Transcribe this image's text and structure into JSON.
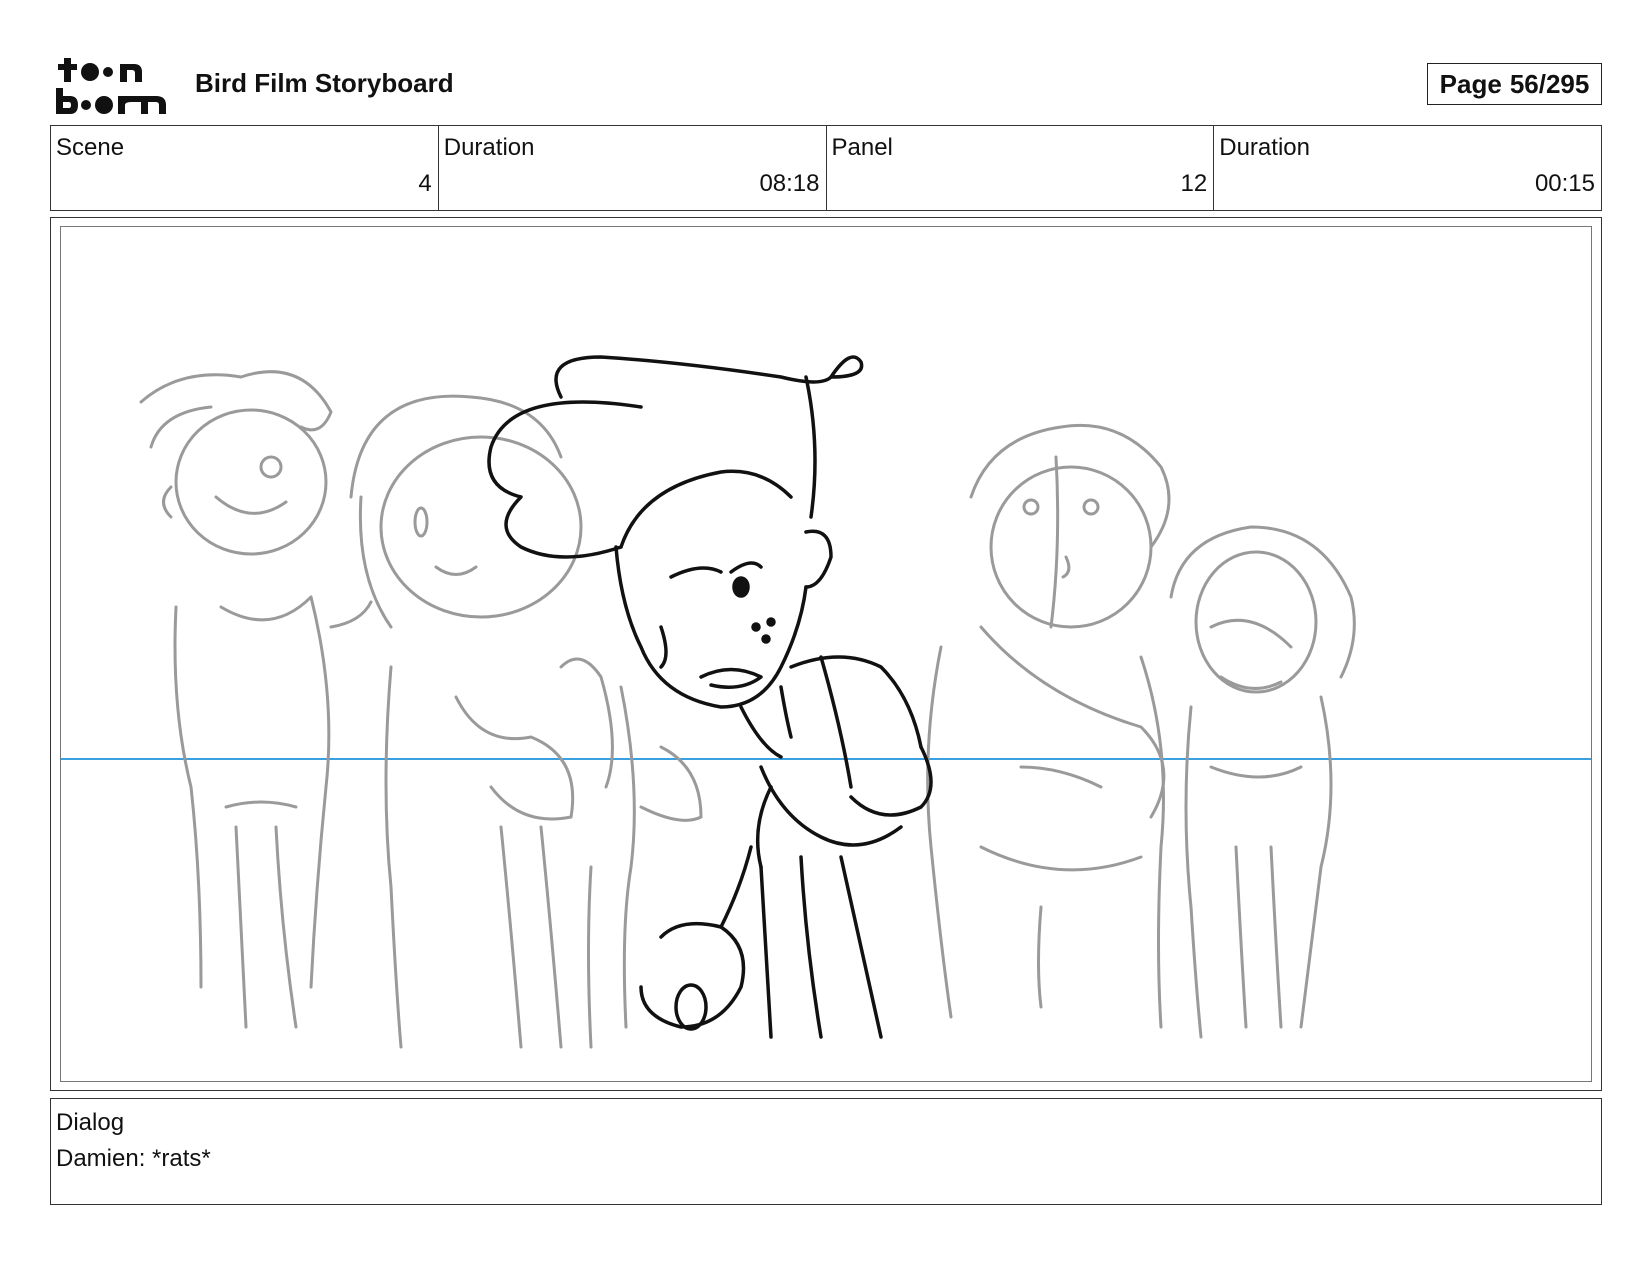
{
  "header": {
    "logo_text_line1": "toon",
    "logo_text_line2": "boom",
    "title": "Bird Film Storyboard",
    "page_label": "Page",
    "page_value": "56/295"
  },
  "info": {
    "scene_label": "Scene",
    "scene_value": "4",
    "scene_duration_label": "Duration",
    "scene_duration_value": "08:18",
    "panel_label": "Panel",
    "panel_value": "12",
    "panel_duration_label": "Duration",
    "panel_duration_value": "00:15"
  },
  "dialog": {
    "label": "Dialog",
    "text": "Damien: *rats*"
  },
  "colors": {
    "horizon_line": "#3aa0e0",
    "sketch_gray": "#9a9a9a",
    "sketch_black": "#111111"
  }
}
